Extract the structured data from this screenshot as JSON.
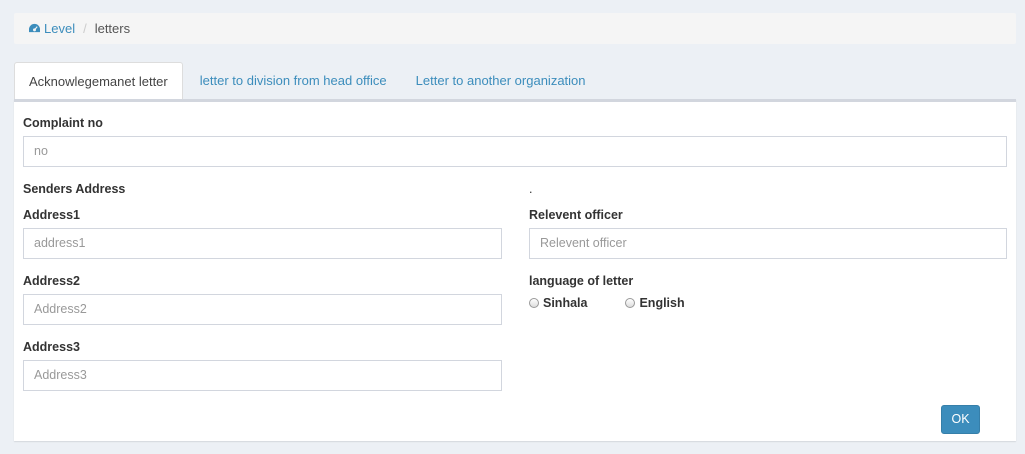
{
  "breadcrumb": {
    "home": "Level",
    "current": "letters"
  },
  "tabs": [
    {
      "label": "Acknowlegemanet letter"
    },
    {
      "label": "letter to division from head office"
    },
    {
      "label": "Letter to another organization"
    }
  ],
  "form": {
    "complaint_label": "Complaint no",
    "complaint_placeholder": "no",
    "senders_heading": "Senders Address",
    "dot": ".",
    "address1_label": "Address1",
    "address1_placeholder": "address1",
    "address2_label": "Address2",
    "address2_placeholder": "Address2",
    "address3_label": "Address3",
    "address3_placeholder": "Address3",
    "officer_label": "Relevent officer",
    "officer_placeholder": "Relevent officer",
    "language_label": "language of letter",
    "language_options": [
      "Sinhala",
      "English"
    ],
    "ok_label": "OK"
  }
}
